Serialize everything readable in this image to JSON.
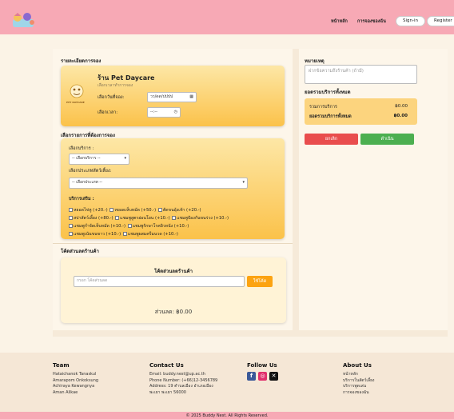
{
  "nav": {
    "home": "หน้าหลัก",
    "my_bookings": "การจองของฉัน",
    "signin": "Sign-in",
    "register": "Register"
  },
  "booking": {
    "section_title": "รายละเอียดการจอง",
    "shop_name": "ร้าน Pet Daycare",
    "shop_subtitle": "เลือกเวลาทำการจอง",
    "shop_logo_text": "PET DAYCARE",
    "date_label": "เลือกวันที่จอง:",
    "date_value": "วว/ดด/ปปปป",
    "time_label": "เลือกเวลา:",
    "time_value": "--:--"
  },
  "services": {
    "section_title": "เลือกรายการที่ต้องการจอง",
    "service_label": "เลือกบริการ :",
    "service_value": "-- เลือกบริการ --",
    "pet_type_label": "เลือกประเภทสัตว์เลี้ยง:",
    "pet_type_value": "-- เลือกประเภท --",
    "addons_label": "บริการเสริม :",
    "addons": [
      "หยอดไข่หู (+20.-)",
      "หยอดเห็บหมัด (+50.-)",
      "ตัดขนอุ้งเท้า (+20.-)",
      "สปาสัตว์เลี้ยง (+80.-)",
      "แชมพูสูตรอ่อนโยน (+10.-)",
      "แชมพูป้องกันขนร่วง (+10.-)",
      "แชมพูกำจัดเห็บหมัด (+10.-)",
      "แชมพูรักษาโรคผิวหนัง (+10.-)",
      "แชมพูเน้นขนขาว (+10.-)",
      "แชมพูผสมครีมนวด (+10.-)"
    ]
  },
  "discount": {
    "section_title": "โค้ดส่วนลดร้านค้า",
    "card_title": "โค้ดส่วนลดร้านค้า",
    "input_placeholder": "กรอก โค้ดส่วนลด",
    "apply_label": "ใช้โค้ด",
    "discount_text": "ส่วนลด: ฿0.00"
  },
  "note": {
    "section_title": "หมายเหตุ",
    "placeholder": "ฝากข้อความถึงร้านค้า (ถ้ามี)"
  },
  "summary": {
    "section_title": "ยอดรวมบริการทั้งหมด",
    "service_total_label": "รวมการบริการ",
    "service_total_value": "฿0.00",
    "grand_total_label": "ยอดรวมบริการทั้งหมด",
    "grand_total_value": "฿0.00",
    "cancel_label": "ยกเลิก",
    "confirm_label": "ดำเนิน"
  },
  "footer": {
    "team_title": "Team",
    "team_members": [
      "Hataichanok Tanaskul",
      "Amarapom Onkoksung",
      "Achiraya Kewangnya",
      "Aman Alikae"
    ],
    "contact_title": "Contact Us",
    "contact_lines": [
      "Email: buddy.nest@up.ac.th",
      "Phone Number: (+66)12-3456789",
      "Address: 19 ตำบลเมือง อำเภอเมือง",
      "พะเยา พะเยา 56000"
    ],
    "follow_title": "Follow Us",
    "about_title": "About Us",
    "about_links": [
      "หน้าหลัก",
      "บริการในสัตว์เลี้ยง",
      "บริการพูดเล่น",
      "การจองของฉัน"
    ],
    "copyright": "© 2025 Buddy Nest. All Rights Reserved."
  },
  "colors": {
    "navbar": "#f7a9b5",
    "card_gradient_top": "#fde7a6",
    "card_gradient_bottom": "#fbc24a",
    "cancel": "#e94d4d",
    "confirm": "#4caf50",
    "apply": "#fca311"
  }
}
